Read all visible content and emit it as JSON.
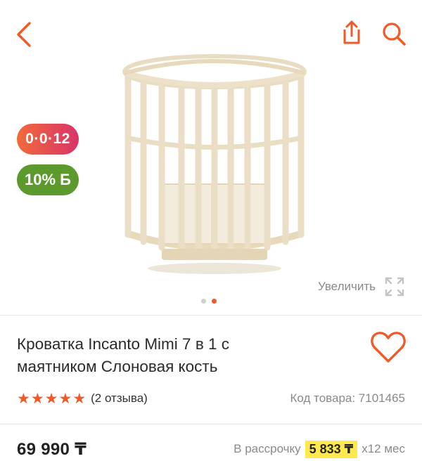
{
  "header": {
    "back_icon": "chevron-left-icon",
    "share_icon": "share-icon",
    "search_icon": "search-icon",
    "accent_color": "#f05a28"
  },
  "gallery": {
    "badges": {
      "installment": "0·0·12",
      "bonus": "10% Б"
    },
    "zoom_label": "Увеличить",
    "zoom_icon": "expand-icon",
    "total_slides": 2,
    "active_slide": 2
  },
  "product": {
    "title_line1": "Кроватка Incanto Mimi 7 в 1 с",
    "title_line2": "маятником Слоновая кость",
    "rating_stars": 5,
    "reviews_label": "(2 отзыва)",
    "code_label": "Код товара: 7101465",
    "favorite_icon": "heart-outline-icon"
  },
  "pricing": {
    "price": "69 990 ₸",
    "installment_prefix": "В рассрочку",
    "installment_amount": "5 833 ₸",
    "installment_term": "x12 мес"
  }
}
